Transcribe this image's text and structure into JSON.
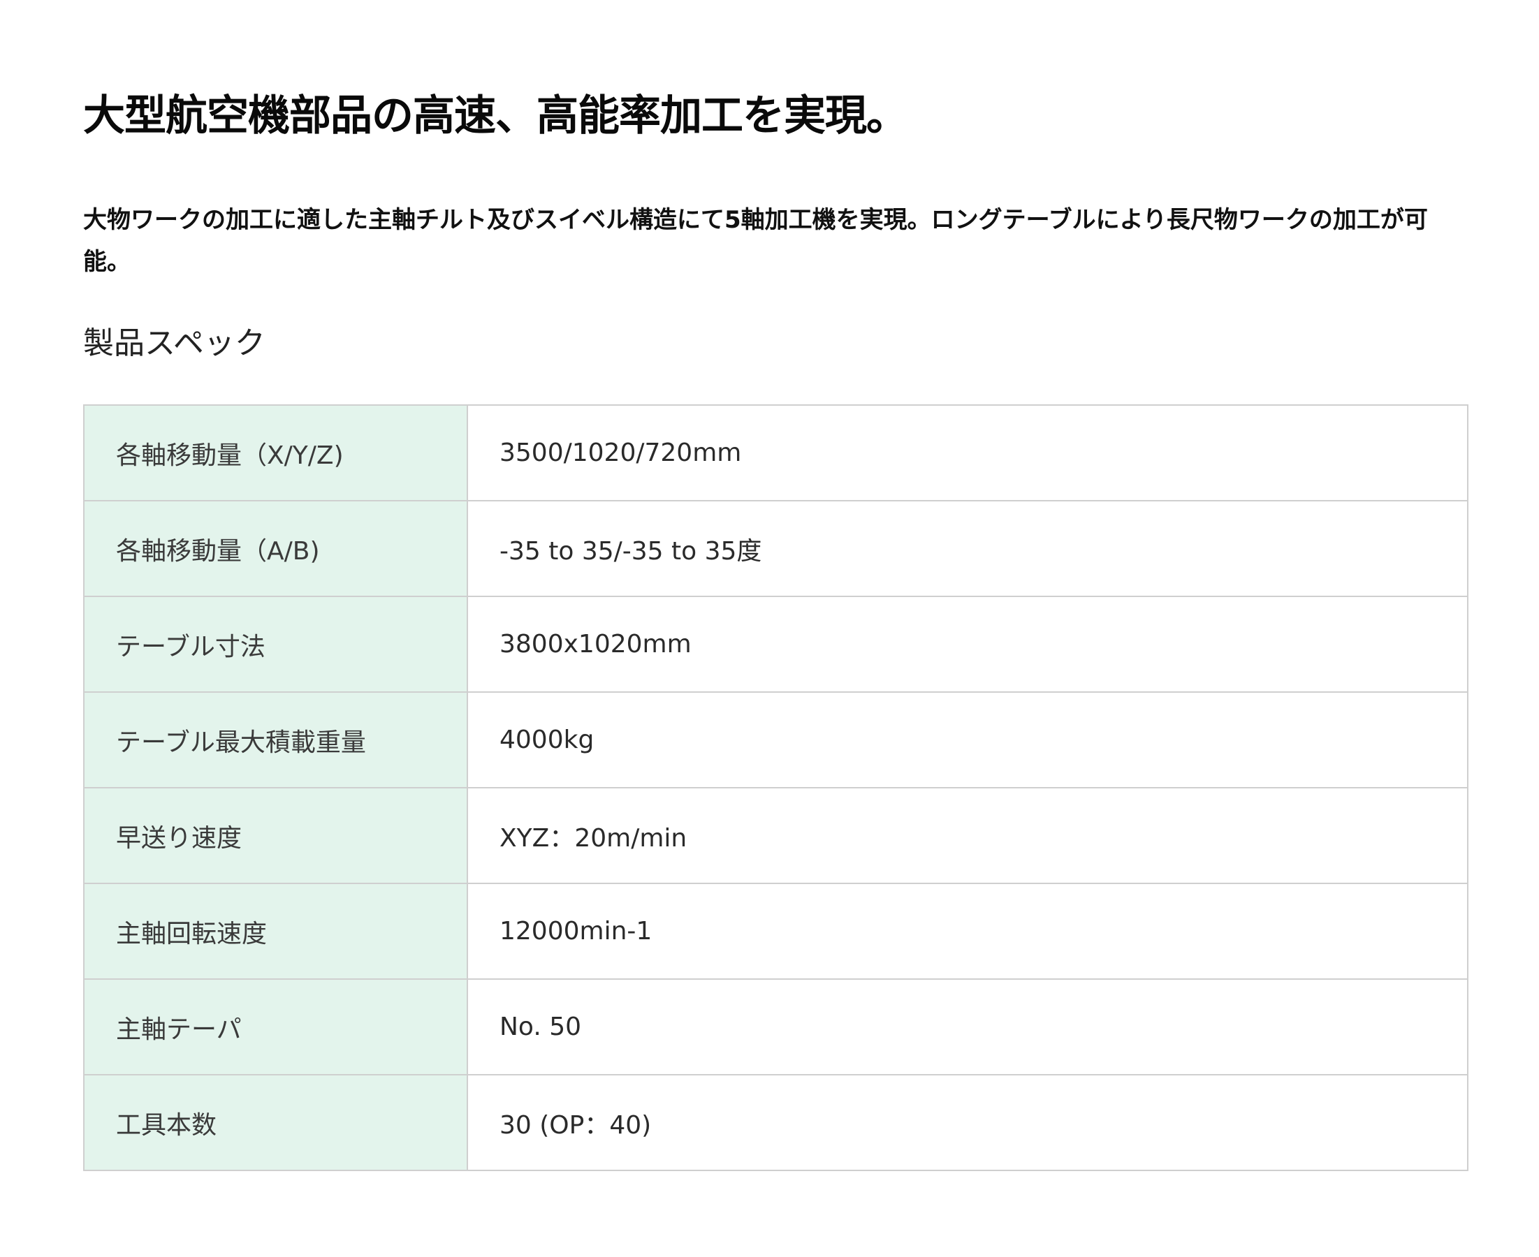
{
  "headline": "大型航空機部品の高速、高能率加工を実現。",
  "lead": "大物ワークの加工に適した主軸チルト及びスイベル構造にて5軸加工機を実現。ロングテーブルにより長尺物ワークの加工が可能。",
  "section_title": "製品スペック",
  "colors": {
    "label_bg": "#e3f4ec",
    "border": "#cfcfcf",
    "text": "#111111"
  },
  "specs": [
    {
      "label": "各軸移動量（X/Y/Z)",
      "value": "3500/1020/720mm"
    },
    {
      "label": "各軸移動量（A/B)",
      "value": "-35 to 35/-35 to 35度"
    },
    {
      "label": "テーブル寸法",
      "value": "3800x1020mm"
    },
    {
      "label": "テーブル最大積載重量",
      "value": "4000kg"
    },
    {
      "label": "早送り速度",
      "value": "XYZ：20m/min"
    },
    {
      "label": "主軸回転速度",
      "value": "12000min-1"
    },
    {
      "label": "主軸テーパ",
      "value": "No. 50"
    },
    {
      "label": "工具本数",
      "value": "30 (OP：40)"
    }
  ]
}
